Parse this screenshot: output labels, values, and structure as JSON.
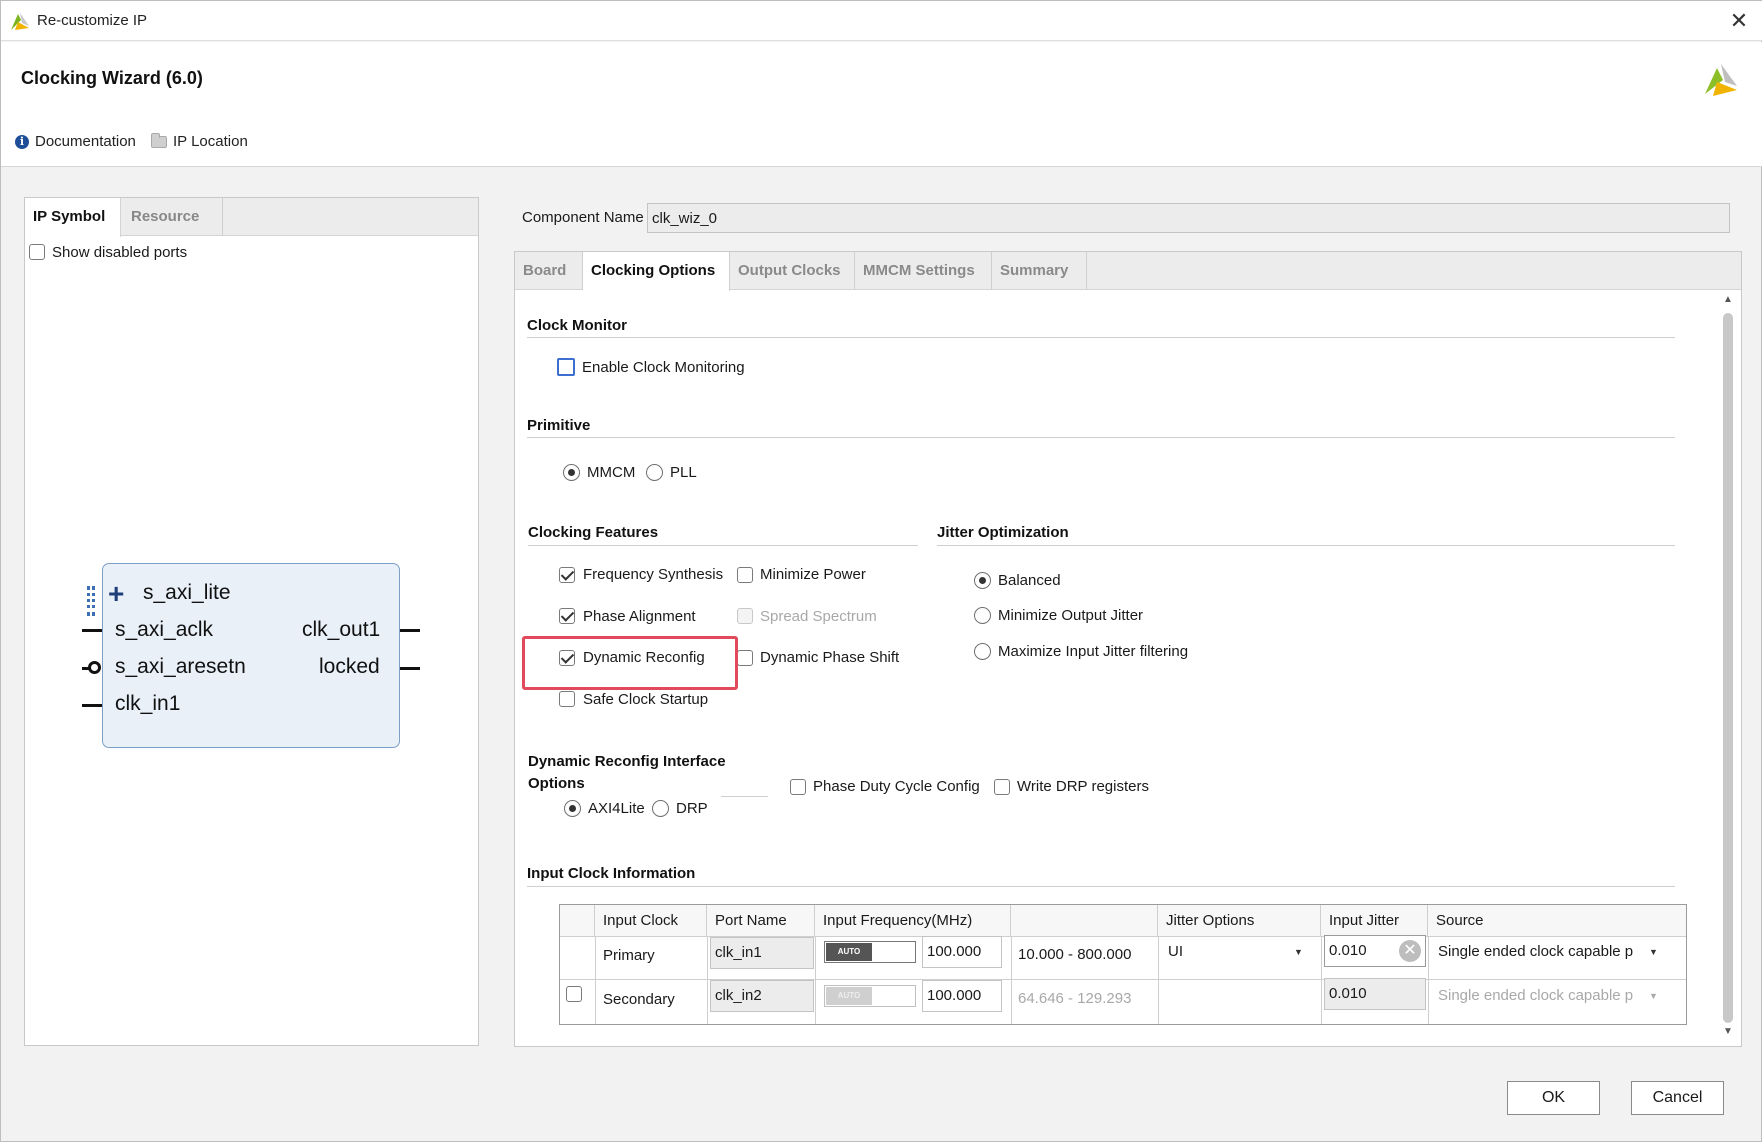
{
  "window": {
    "title": "Re-customize IP",
    "close_label": "✕"
  },
  "header": {
    "wizard_title": "Clocking Wizard (6.0)",
    "links": {
      "documentation": "Documentation",
      "ip_location": "IP Location"
    }
  },
  "left_panel": {
    "tabs": [
      "IP Symbol",
      "Resource"
    ],
    "show_disabled_ports": "Show disabled ports",
    "symbol": {
      "bus_port": "s_axi_lite",
      "inputs": [
        "s_axi_aclk",
        "s_axi_aresetn",
        "clk_in1"
      ],
      "outputs": [
        "clk_out1",
        "locked"
      ],
      "plus": "+"
    }
  },
  "component": {
    "label": "Component Name",
    "value": "clk_wiz_0"
  },
  "tabs": [
    "Board",
    "Clocking Options",
    "Output Clocks",
    "MMCM Settings",
    "Summary"
  ],
  "clock_monitor": {
    "title": "Clock Monitor",
    "enable_label": "Enable Clock Monitoring",
    "enabled": false
  },
  "primitive": {
    "title": "Primitive",
    "options": [
      "MMCM",
      "PLL"
    ],
    "selected": "MMCM"
  },
  "clocking_features": {
    "title": "Clocking Features",
    "frequency_synthesis": "Frequency Synthesis",
    "minimize_power": "Minimize Power",
    "phase_alignment": "Phase Alignment",
    "spread_spectrum": "Spread Spectrum",
    "dynamic_reconfig": "Dynamic Reconfig",
    "dynamic_phase_shift": "Dynamic Phase Shift",
    "safe_clock_startup": "Safe Clock Startup"
  },
  "jitter_optimization": {
    "title": "Jitter Optimization",
    "options": [
      "Balanced",
      "Minimize Output Jitter",
      "Maximize Input Jitter filtering"
    ],
    "selected": "Balanced"
  },
  "dynamic_reconfig_interface": {
    "title_line1": "Dynamic Reconfig Interface",
    "title_line2": "Options",
    "options": [
      "AXI4Lite",
      "DRP"
    ],
    "selected": "AXI4Lite",
    "phase_duty_cycle": "Phase Duty Cycle Config",
    "write_drp": "Write DRP registers"
  },
  "input_clock_info": {
    "title": "Input Clock Information",
    "columns": [
      "Input Clock",
      "Port Name",
      "Input Frequency(MHz)",
      "",
      "Jitter Options",
      "Input Jitter",
      "Source"
    ],
    "auto_label": "AUTO",
    "rows": [
      {
        "input_clock": "Primary",
        "port_name": "clk_in1",
        "frequency": "100.000",
        "range": "10.000 - 800.000",
        "jitter_option": "UI",
        "input_jitter": "0.010",
        "source": "Single ended clock capable pi"
      },
      {
        "input_clock": "Secondary",
        "port_name": "clk_in2",
        "frequency": "100.000",
        "range": "64.646 - 129.293",
        "jitter_option": "",
        "input_jitter": "0.010",
        "source": "Single ended clock capable pi"
      }
    ]
  },
  "buttons": {
    "ok": "OK",
    "cancel": "Cancel"
  },
  "colors": {
    "highlight": "#e14a5a",
    "ip_block_fill": "#e9f0f8",
    "focus_blue": "#3d6fd1"
  }
}
